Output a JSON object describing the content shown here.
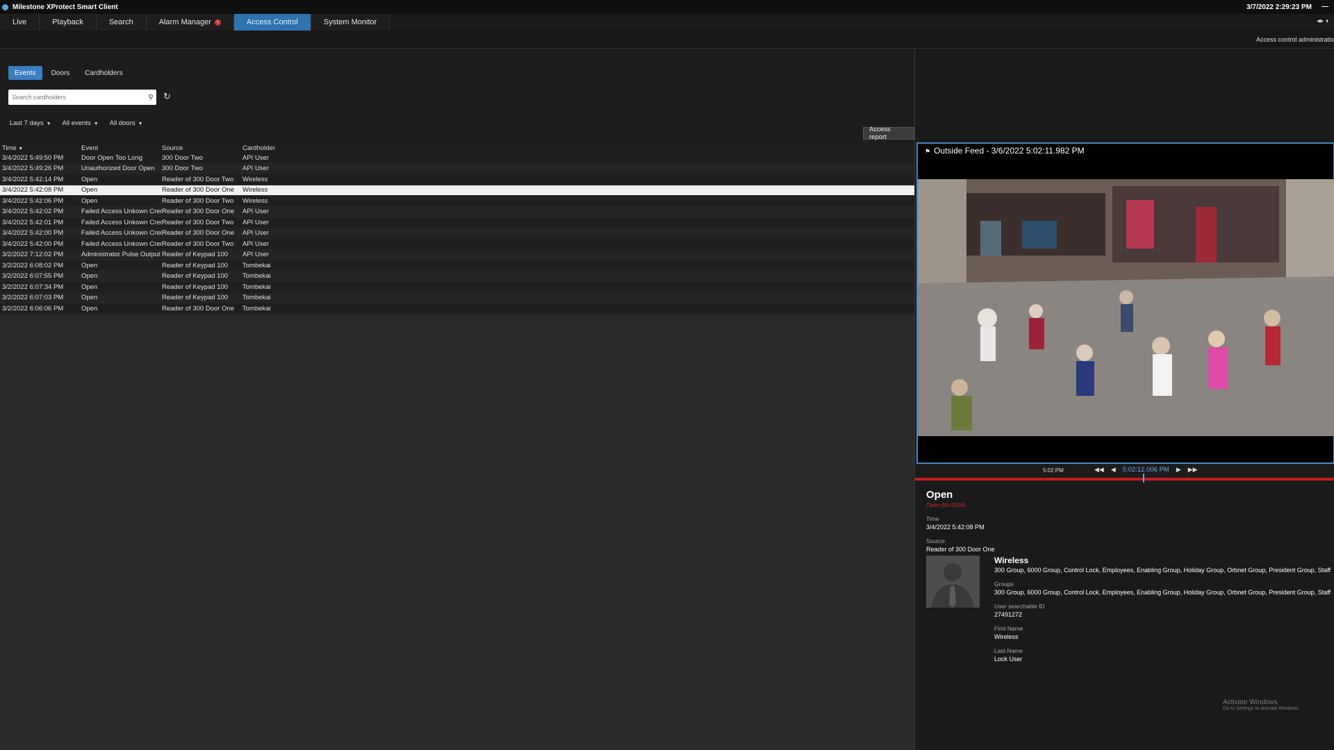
{
  "app": {
    "title": "Milestone XProtect Smart Client",
    "clock": "3/7/2022 2:29:23 PM",
    "min_glyph": "—"
  },
  "nav": {
    "tabs": [
      {
        "label": "Live"
      },
      {
        "label": "Playback"
      },
      {
        "label": "Search"
      },
      {
        "label": "Alarm Manager",
        "badge": "!"
      },
      {
        "label": "Access Control",
        "active": true
      },
      {
        "label": "System Monitor"
      }
    ],
    "right_icons": "◂▸ ◐"
  },
  "subbar": {
    "admin_label": "Access control administratio"
  },
  "view_tabs": [
    "Events",
    "Doors",
    "Cardholders"
  ],
  "search": {
    "placeholder": "Search cardholders",
    "value": "",
    "icon": "search-icon"
  },
  "filters": [
    "Last 7 days",
    "All events",
    "All doors"
  ],
  "report_button": "Access report",
  "table": {
    "headers": {
      "time": "Time",
      "event": "Event",
      "source": "Source",
      "cardholder": "Cardholder"
    },
    "rows": [
      {
        "time": "3/4/2022 5:49:50 PM",
        "event": "Door Open Too Long",
        "source": "300 Door Two",
        "cardholder": "API User"
      },
      {
        "time": "3/4/2022 5:49:26 PM",
        "event": "Unauthorized Door Open",
        "source": "300 Door Two",
        "cardholder": "API User"
      },
      {
        "time": "3/4/2022 5:42:14 PM",
        "event": "Open",
        "source": "Reader of 300 Door Two",
        "cardholder": "Wireless"
      },
      {
        "time": "3/4/2022 5:42:08 PM",
        "event": "Open",
        "source": "Reader of 300 Door One",
        "cardholder": "Wireless",
        "selected": true
      },
      {
        "time": "3/4/2022 5:42:06 PM",
        "event": "Open",
        "source": "Reader of 300 Door Two",
        "cardholder": "Wireless"
      },
      {
        "time": "3/4/2022 5:42:02 PM",
        "event": "Failed Access Unkown Credi",
        "source": "Reader of 300 Door One",
        "cardholder": "API User"
      },
      {
        "time": "3/4/2022 5:42:01 PM",
        "event": "Failed Access Unkown Credi",
        "source": "Reader of 300 Door Two",
        "cardholder": "API User"
      },
      {
        "time": "3/4/2022 5:42:00 PM",
        "event": "Failed Access Unkown Credi",
        "source": "Reader of 300 Door One",
        "cardholder": "API User"
      },
      {
        "time": "3/4/2022 5:42:00 PM",
        "event": "Failed Access Unkown Credi",
        "source": "Reader of 300 Door Two",
        "cardholder": "API User"
      },
      {
        "time": "3/2/2022 7:12:02 PM",
        "event": "Administrator Pulse Output",
        "source": "Reader of Keypad 100",
        "cardholder": "API User"
      },
      {
        "time": "3/2/2022 6:08:02 PM",
        "event": "Open",
        "source": "Reader of Keypad 100",
        "cardholder": "Tombekai"
      },
      {
        "time": "3/2/2022 6:07:55 PM",
        "event": "Open",
        "source": "Reader of Keypad 100",
        "cardholder": "Tombekai"
      },
      {
        "time": "3/2/2022 6:07:34 PM",
        "event": "Open",
        "source": "Reader of Keypad 100",
        "cardholder": "Tombekai"
      },
      {
        "time": "3/2/2022 6:07:03 PM",
        "event": "Open",
        "source": "Reader of Keypad 100",
        "cardholder": "Tombekai"
      },
      {
        "time": "3/2/2022 6:06:06 PM",
        "event": "Open",
        "source": "Reader of 300 Door One",
        "cardholder": "Tombekai"
      }
    ]
  },
  "video": {
    "title": "Outside Feed - 3/6/2022 5:02:11.982 PM",
    "timeline_label": "5:02 PM",
    "current_time": "5:02:12.006 PM"
  },
  "details": {
    "event_title": "Open",
    "event_sub": "Open (Id=2004)",
    "time_label": "Time",
    "time_value": "3/4/2022 5:42:08 PM",
    "source_label": "Source",
    "source_value": "Reader of 300 Door One",
    "cardholder": {
      "name": "Wireless",
      "summary": "300 Group, 6000 Group, Control Lock, Employees, Enabling Group, Holiday Group, Orbnet Group, President Group, Staff",
      "groups_label": "Groups",
      "groups_value": "300 Group, 6000 Group, Control Lock, Employees, Enabling Group, Holiday Group, Orbnet Group, President Group, Staff",
      "id_label": "User searchable ID",
      "id_value": "27491272",
      "first_label": "First Name",
      "first_value": "Wireless",
      "last_label": "Last Name",
      "last_value": "Lock User"
    }
  },
  "watermark": {
    "line1": "Activate Windows",
    "line2": "Go to Settings to activate Windows."
  }
}
